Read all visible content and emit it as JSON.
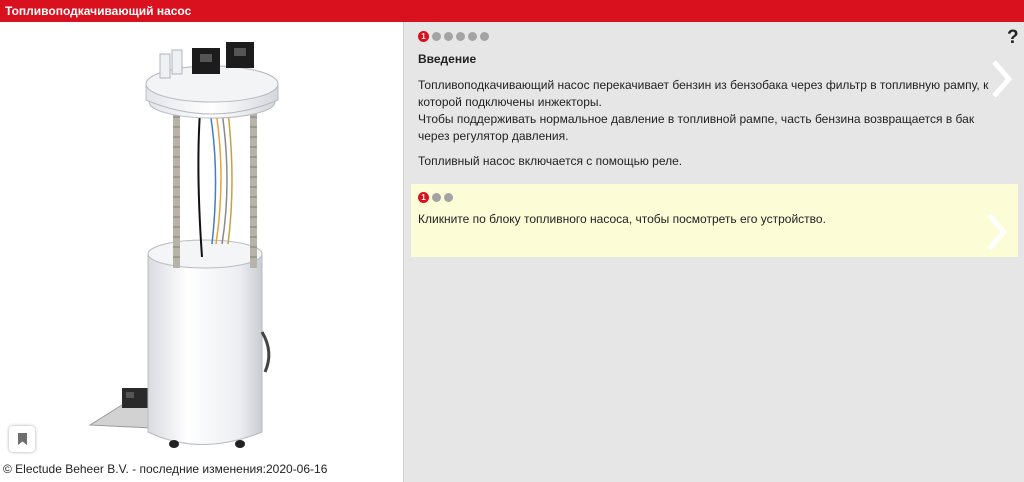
{
  "window": {
    "title": "Топливоподкачивающий насос"
  },
  "footer": {
    "copyright": "© Electude Beheer B.V. - последние изменения:2020-06-16"
  },
  "intro": {
    "step_number": "1",
    "title": "Введение",
    "paragraphs": [
      "Топливоподкачивающий насос перекачивает бензин из бензобака через фильтр в топливную рампу, к которой подключены инжекторы.",
      "Чтобы поддерживать нормальное давление в топливной рампе, часть бензина возвращается в бак через регулятор давления.",
      "Топливный насос включается с помощью реле."
    ],
    "total_steps": 6,
    "current_step": 1
  },
  "task": {
    "step_number": "1",
    "text": "Кликните по блоку топливного насоса, чтобы посмотреть его устройство.",
    "total_steps": 3,
    "current_step": 1,
    "background": "#fcfcd6"
  },
  "help": {
    "label": "?"
  },
  "icons": {
    "bookmark": "bookmark-icon",
    "next": "chevron-right-icon"
  },
  "colors": {
    "accent": "#d9101e",
    "panel": "#e6e6e6",
    "dot_inactive": "#a3a3a3"
  }
}
